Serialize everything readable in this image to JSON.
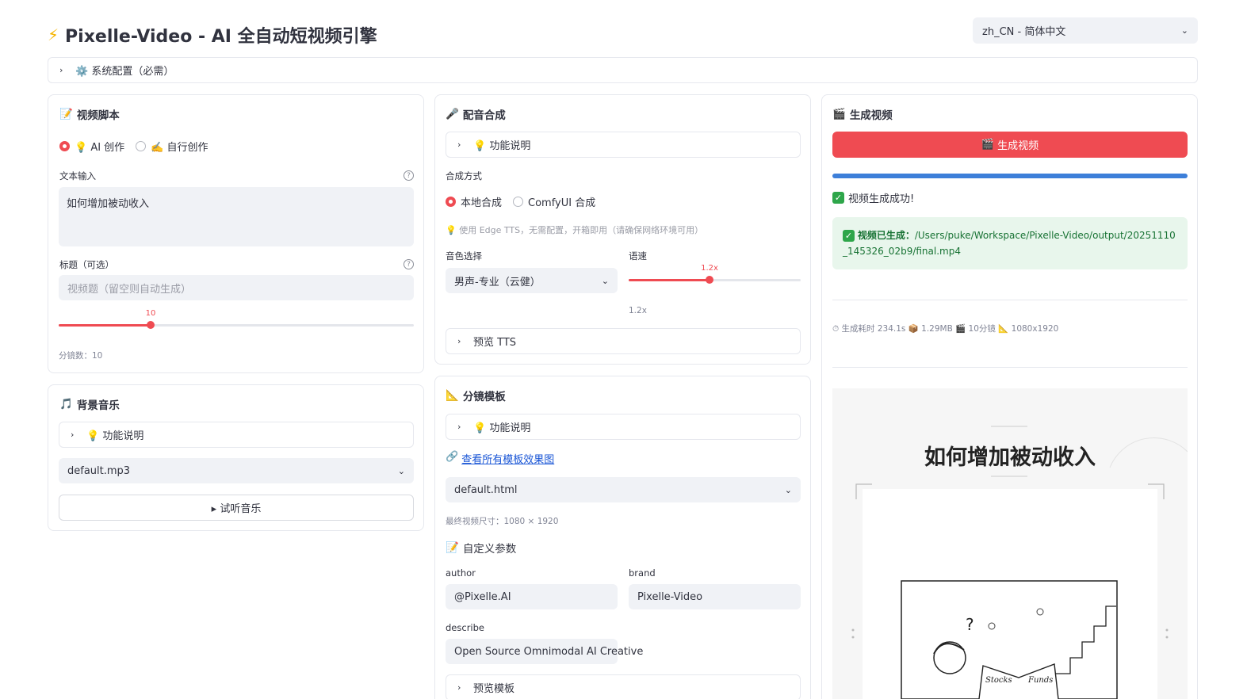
{
  "app": {
    "title": "Pixelle-Video - AI 全自动短视频引擎",
    "language": "zh_CN - 简体中文"
  },
  "system_config": {
    "label": "⚙️ 系统配置（必需）"
  },
  "script_panel": {
    "title": "视频脚本",
    "mode_options": [
      "💡 AI 创作",
      "✍️ 自行创作"
    ],
    "text_label": "文本输入",
    "text_value": "如何增加被动收入",
    "title_label": "标题（可选）",
    "title_placeholder": "视频题（留空则自动生成）",
    "scenes_value": "10",
    "scenes_fraction": 0.26,
    "scenes_caption": "分镜数：10"
  },
  "bgm_panel": {
    "title": "背景音乐",
    "help_label": "💡 功能说明",
    "selected": "default.mp3",
    "play_label": "▸ 试听音乐"
  },
  "tts_panel": {
    "title": "配音合成",
    "help_label": "💡 功能说明",
    "method_label": "合成方式",
    "method_options": [
      "本地合成",
      "ComfyUI 合成"
    ],
    "hint": "💡 使用 Edge TTS，无需配置，开箱即用（请确保网络环境可用）",
    "voice_label": "音色选择",
    "voice_value": "男声-专业（云健）",
    "speed_label": "语速",
    "speed_value": "1.2x",
    "speed_fraction": 0.47,
    "speed_caption": "1.2x",
    "preview_label": "预览 TTS"
  },
  "template_panel": {
    "title": "分镜模板",
    "help_label": "💡 功能说明",
    "link_label": "查看所有模板效果图",
    "selected": "default.html",
    "size_caption": "最终视频尺寸：1080 × 1920",
    "custom_title": "自定义参数",
    "author_label": "author",
    "author_value": "@Pixelle.AI",
    "brand_label": "brand",
    "brand_value": "Pixelle-Video",
    "describe_label": "describe",
    "describe_value": "Open Source Omnimodal AI Creative",
    "preview_label": "预览模板"
  },
  "generate_panel": {
    "title": "生成视频",
    "button_label": "生成视频",
    "progress": 1.0,
    "status": "视频生成成功!",
    "result_prefix": "视频已生成：",
    "result_path": "/Users/puke/Workspace/Pixelle-Video/output/20251110_145326_02b9/final.mp4",
    "stats": "⏱ 生成耗时 234.1s 📦 1.29MB 🎬 10分镜 📐 1080x1920",
    "preview_title": "如何增加被动收入",
    "preview_book_words": [
      "Stocks",
      "Funds"
    ]
  },
  "colors": {
    "accent": "#ef4b52",
    "progress": "#3d7fd9",
    "success_bg": "#e8f6ec"
  }
}
